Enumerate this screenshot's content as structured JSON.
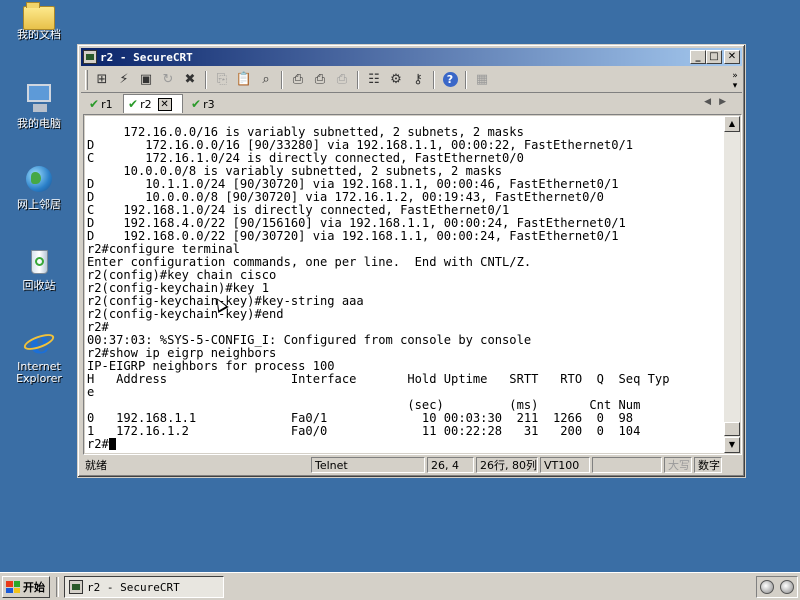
{
  "desktop": {
    "icons": [
      {
        "label": "我的文档",
        "icon": "my-documents-icon"
      },
      {
        "label": "我的电脑",
        "icon": "my-computer-icon"
      },
      {
        "label": "网上邻居",
        "icon": "network-places-icon"
      },
      {
        "label": "回收站",
        "icon": "recycle-bin-icon"
      },
      {
        "label": "Internet Explorer",
        "icon": "internet-explorer-icon"
      }
    ]
  },
  "window": {
    "title": "r2 - SecureCRT",
    "controls": {
      "minimize": "_",
      "maximize": "□",
      "close": "✕"
    }
  },
  "toolbar": {
    "buttons": [
      "connect-icon",
      "quick-connect-icon",
      "connect-tab-icon",
      "reconnect-icon",
      "disconnect-icon",
      "copy-icon",
      "paste-icon",
      "find-icon",
      "print-icon",
      "print-selection-icon",
      "print-setup-icon",
      "session-options-icon",
      "global-options-icon",
      "keymap-icon",
      "help-icon",
      "sftp-icon"
    ]
  },
  "tabs": [
    {
      "label": "r1",
      "active": false
    },
    {
      "label": "r2",
      "active": true
    },
    {
      "label": "r3",
      "active": false
    }
  ],
  "terminal": {
    "lines": [
      "     172.16.0.0/16 is variably subnetted, 2 subnets, 2 masks",
      "D       172.16.0.0/16 [90/33280] via 192.168.1.1, 00:00:22, FastEthernet0/1",
      "C       172.16.1.0/24 is directly connected, FastEthernet0/0",
      "     10.0.0.0/8 is variably subnetted, 2 subnets, 2 masks",
      "D       10.1.1.0/24 [90/30720] via 192.168.1.1, 00:00:46, FastEthernet0/1",
      "D       10.0.0.0/8 [90/30720] via 172.16.1.2, 00:19:43, FastEthernet0/0",
      "C    192.168.1.0/24 is directly connected, FastEthernet0/1",
      "D    192.168.4.0/22 [90/156160] via 192.168.1.1, 00:00:24, FastEthernet0/1",
      "D    192.168.0.0/22 [90/30720] via 192.168.1.1, 00:00:24, FastEthernet0/1",
      "r2#configure terminal",
      "Enter configuration commands, one per line.  End with CNTL/Z.",
      "r2(config)#key chain cisco",
      "r2(config-keychain)#key 1",
      "r2(config-keychain-key)#key-string aaa",
      "r2(config-keychain-key)#end",
      "r2#",
      "00:37:03: %SYS-5-CONFIG_I: Configured from console by console",
      "r2#show ip eigrp neighbors",
      "IP-EIGRP neighbors for process 100",
      "H   Address                 Interface       Hold Uptime   SRTT   RTO  Q  Seq Typ",
      "e",
      "                                            (sec)         (ms)       Cnt Num",
      "0   192.168.1.1             Fa0/1             10 00:03:30  211  1266  0  98",
      "1   172.16.1.2              Fa0/0             11 00:22:28   31   200  0  104"
    ],
    "prompt": "r2#"
  },
  "statusbar": {
    "ready": "就绪",
    "protocol": "Telnet",
    "position": "26,  4",
    "rows_cols": "26行, 80列",
    "emulation": "VT100",
    "caps": "大写",
    "num": "数字"
  },
  "taskbar": {
    "start_label": "开始",
    "task_label": "r2 - SecureCRT"
  }
}
